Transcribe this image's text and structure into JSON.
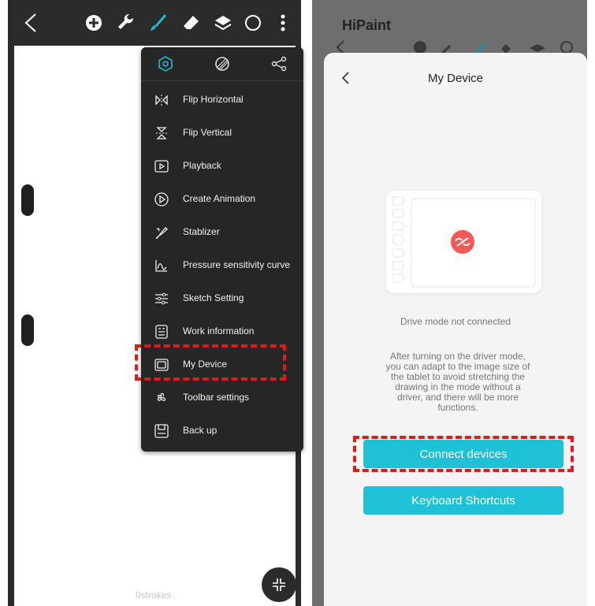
{
  "left_phone": {
    "toolbar": {
      "icons": [
        "back-chevron-icon",
        "add-circle-icon",
        "wrench-icon",
        "brush-icon",
        "eraser-icon",
        "layers-icon",
        "color-circle-icon",
        "more-vertical-icon"
      ]
    },
    "menu": {
      "tabs": [
        "settings-hexagon-icon",
        "canvas-texture-icon",
        "share-icon"
      ],
      "active_tab_color": "#22b8cf",
      "items": [
        {
          "label": "Flip Horizontal",
          "icon": "flip-horizontal-icon"
        },
        {
          "label": "Flip Vertical",
          "icon": "flip-vertical-icon"
        },
        {
          "label": "Playback",
          "icon": "playback-icon"
        },
        {
          "label": "Create Animation",
          "icon": "create-animation-icon"
        },
        {
          "label": "Stablizer",
          "icon": "stabilizer-icon"
        },
        {
          "label": "Pressure sensitivity curve",
          "icon": "pressure-curve-icon"
        },
        {
          "label": "Sketch Setting",
          "icon": "sketch-setting-icon"
        },
        {
          "label": "Work information",
          "icon": "work-information-icon"
        },
        {
          "label": "My Device",
          "icon": "my-device-icon",
          "highlighted": true
        },
        {
          "label": "Toolbar settings",
          "icon": "toolbar-settings-icon"
        },
        {
          "label": "Back up",
          "icon": "back-up-icon"
        }
      ]
    },
    "stroke_count": "0strokes",
    "fab_icon": "collapse-arrows-icon"
  },
  "right_phone": {
    "app_title": "HiPaint",
    "sheet": {
      "title": "My Device",
      "back_icon": "back-chevron-icon",
      "illustration": "tablet-disconnected-icon",
      "status": "Drive mode not connected",
      "description": "After turning on the driver mode, you can adapt to the image size of the tablet to avoid stretching the drawing in the mode without a driver, and there will be more functions.",
      "connect_label": "Connect devices",
      "shortcuts_label": "Keyboard Shortcuts",
      "button_color": "#1ec1d6",
      "unlink_badge_color": "#f25a5a"
    }
  },
  "highlight_color": "#e01a1a"
}
